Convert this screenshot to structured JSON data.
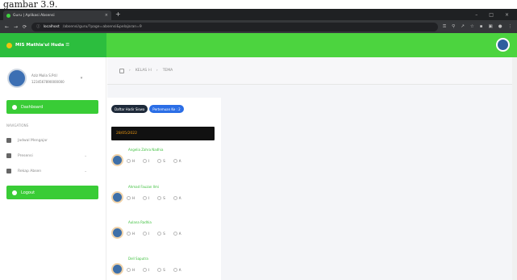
{
  "caption": "gambar 3.9.",
  "browser": {
    "tab_title": "Guru | Aplikasi Absensi",
    "tab_close": "×",
    "new_tab": "+",
    "window_controls": [
      "–",
      "□",
      "×"
    ],
    "url_host": "localhost",
    "url_path": "/absensi/guru/?page=absensi&pelajaran=9"
  },
  "header": {
    "brand": "MIS Mathla'ul Huda ☰"
  },
  "sidebar": {
    "user_name": "Aziz Mulia S.Pd.I",
    "user_id": "1234567890000000",
    "active_item": "Dashboard",
    "section_label": "NAVIGATIONS",
    "items": [
      {
        "label": "Jadwal Mengajar",
        "icon": "calendar-icon",
        "has_caret": false
      },
      {
        "label": "Presensi",
        "icon": "clipboard-icon",
        "has_caret": true
      },
      {
        "label": "Rekap Absen",
        "icon": "chart-icon",
        "has_caret": true
      }
    ],
    "logout": "Logout"
  },
  "breadcrumb": {
    "items": [
      "KELAS I-I",
      "TEMA"
    ],
    "sep": "›"
  },
  "main": {
    "btn_absen": "Daftar Hadir Siswa",
    "btn_pertemuan": "Pertemuan Ke : 2",
    "date": "28/05/2022",
    "options": [
      "H",
      "I",
      "S",
      "A"
    ],
    "students": [
      {
        "name": "Angelia Zahra Nadhia"
      },
      {
        "name": "Ahmad Fauzan Ilmi"
      },
      {
        "name": "Aulana Radhia"
      },
      {
        "name": "Dell Saputra"
      }
    ]
  }
}
